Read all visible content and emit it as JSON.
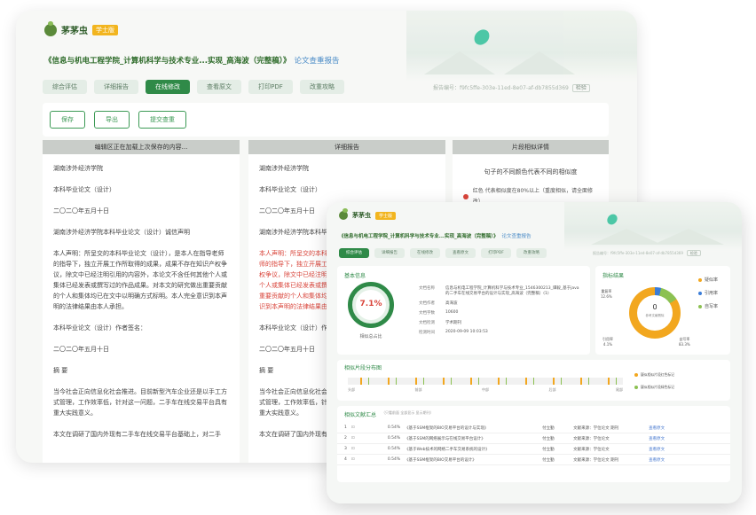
{
  "brand": {
    "name": "茅茅虫",
    "badge": "学士版"
  },
  "report": {
    "title": "《信息与机电工程学院_计算机科学与技术专业...实现_高海波（完整稿）》",
    "subtitle": "论文查重报告",
    "fingerprint": "报告编号：f9fc5ffe-303e-11ed-8e07-af-db7855d369",
    "verify": "检验"
  },
  "tabs": [
    "综合评估",
    "详细报告",
    "在线修改",
    "查看原文",
    "打印PDF",
    "改重攻略"
  ],
  "toolbar": {
    "save": "保存",
    "export": "导出",
    "submit": "提交查重"
  },
  "columns": {
    "editor_head": "编辑区正在加载上次保存的内容...",
    "detail_head": "详细报告",
    "similar_head": "片段相似详情"
  },
  "editor_paragraphs": [
    "湖南涉外经济学院",
    "本科毕业论文（设计）",
    "二〇二〇年五月十日",
    "湖南涉外经济学院本科毕业论文（设计）诚信声明",
    "本人声明：所呈交的本科毕业论文（设计），是本人在指导老师的指导下，独立开展工作所取得的成果，成果不存在知识产权争议，除文中已经注明引用的内容外，本论文不含任何其他个人或集体已经发表或撰写过的作品成果。对本文的研究做出重要贡献的个人和集体均已在文中以明确方式标明。本人完全意识到本声明的法律结果由本人承担。",
    "本科毕业论文（设计）作者签名：",
    "二〇二〇年五月十日",
    "摘 要",
    "当今社会正向信息化社会推进。目前新型汽车企业还是以手工方式管理，工作效率低，针对这一问题，二手车在线交易平台具有重大实践意义。",
    "本文在调研了国内外现有二手车在线交易平台基础上，对二手"
  ],
  "detail_paragraphs": [
    "湖南涉外经济学院",
    "本科毕业论文（设计）",
    "二〇二〇年五月十日",
    "湖南涉外经济学院本科毕业论文（设计）诚信声明",
    "本人声明：所呈交的本科毕业论文（设计）",
    "师的指导下，独立开展工作所取得的成果",
    "权争议，除文中已经注明引用的内容外",
    "个人或集体已经发表或撰写过的作品成",
    "重要贡献的个人和集体均已在文中以明",
    "识到本声明的法律结果由本",
    "本科毕业论文（设计）作",
    "二〇二〇年五月十日",
    "摘 要",
    "当今社会正向信息化社会推进。目前新型汽车企业还是以手工方式管理，工作效率低，针对这一问题，二手车在线交易平台具有重大实践意义。",
    "本文在调研了国内外现有"
  ],
  "similar": {
    "heading": "句子的不同颜色代表不同的相似度",
    "legend_red": "红色 代表相似度在80%以上（重度相似，请全面修改）",
    "red_color": "#d9443a"
  },
  "front": {
    "title": "《信息与机电工程学院_计算机科学与技术专业...实现_高海波（完整稿）》",
    "subtitle": "论文查重报告",
    "basic_title": "基本信息",
    "score": "7.1%",
    "score_label": "相似总占比",
    "info": [
      {
        "k": "文档名称",
        "v": "信息与机电工程学院_计算机科学与技术专业_1546300213_谭毅_基于java的二手车在线交易平台的设计与实现_高海波（完整稿）(1)"
      },
      {
        "k": "文档作者",
        "v": "高海波"
      },
      {
        "k": "文档字数",
        "v": "10600"
      },
      {
        "k": "文档检测",
        "v": "学术期刊"
      },
      {
        "k": "检测时间",
        "v": "2020-09-09 10:03:53"
      }
    ],
    "stats_title": "指标结果",
    "donut_center": "0",
    "donut_sub": "参考文献剔除",
    "stats_legend": [
      "疑似率",
      "引用率",
      "自写率"
    ],
    "stats_values": [
      "12.6%",
      "4.1%",
      "83.3%"
    ],
    "stats_labels": [
      "重复率",
      "引用率",
      "自写率"
    ],
    "dist_title": "相似片段分布图",
    "dist_legend": [
      "疑似相似片段红色标记",
      "疑似相似片段绿色标记"
    ],
    "dist_axis": [
      "头部",
      "前部",
      "中部",
      "后部",
      "尾部"
    ],
    "list_title": "相似文献汇总",
    "list_filter": "（只看前面  全部显示  显示期刊）",
    "list_rows": [
      {
        "n": "1",
        "pct": "0.54%",
        "src": "《基于SSM框架的BIO交易平台的设计与实现》",
        "auth": "付立勤",
        "desc": "文献来源：学位论文 期刊",
        "link": "查看原文"
      },
      {
        "n": "2",
        "pct": "0.54%",
        "src": "《基于SSM的网络展示与在线交易平台设计》",
        "auth": "付立勤",
        "desc": "文献来源：学位论文",
        "link": "查看原文"
      },
      {
        "n": "3",
        "pct": "0.54%",
        "src": "《基于Web技术的网络二手车交易系统的设计》",
        "auth": "付立勤",
        "desc": "文献来源：学位论文",
        "link": "查看原文"
      },
      {
        "n": "4",
        "pct": "0.54%",
        "src": "《基于SSM框架的BIO交易平台的设计》",
        "auth": "付立勤",
        "desc": "文献来源：学位论文 期刊",
        "link": "查看原文"
      }
    ],
    "colors": {
      "green": "#2f8a48",
      "orange": "#f2a71f",
      "blue": "#3b7dd8",
      "lime": "#8cc152"
    }
  }
}
